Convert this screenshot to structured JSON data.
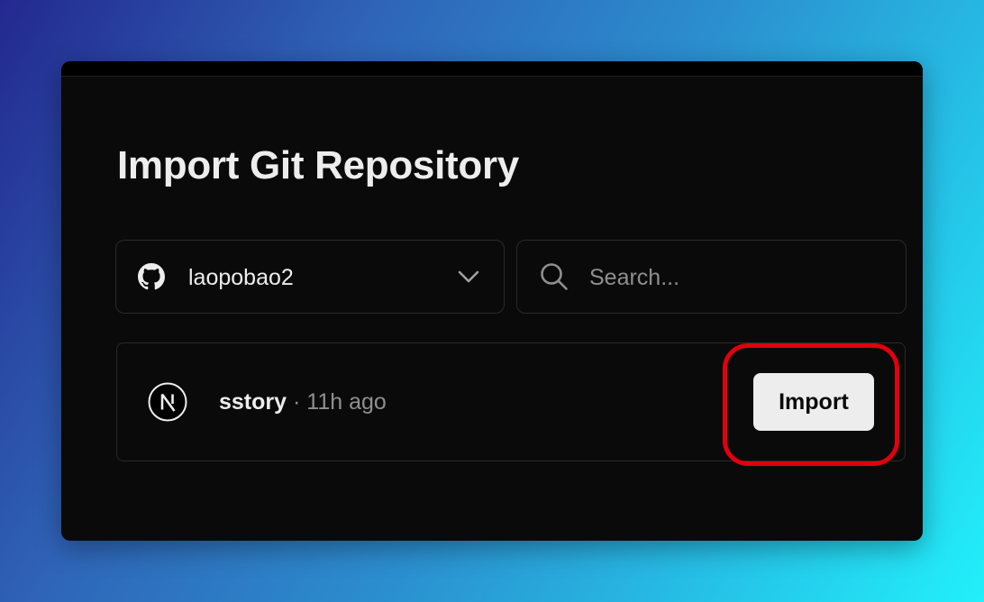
{
  "page": {
    "title": "Import Git Repository"
  },
  "account_selector": {
    "provider_icon": "github-icon",
    "account_name": "laopobao2",
    "dropdown_icon": "chevron-down-icon"
  },
  "search": {
    "icon": "search-icon",
    "placeholder": "Search..."
  },
  "repositories": [
    {
      "framework_icon": "nextjs-icon",
      "name": "sstory",
      "separator": "·",
      "updated": "11h ago",
      "action_label": "Import"
    }
  ],
  "annotation": {
    "highlight_color": "#e0000e",
    "target": "import-button"
  },
  "colors": {
    "background_gradient": [
      "#23288f",
      "#2b8fcf",
      "#22f0fa"
    ],
    "panel": "#0a0a0a",
    "text_primary": "#ededed",
    "text_muted": "#8f8f8f",
    "border": "#2a2a2a",
    "button_bg": "#ededed"
  }
}
